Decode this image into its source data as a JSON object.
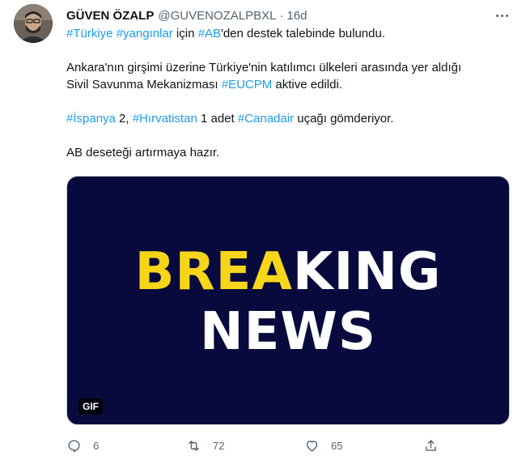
{
  "tweet": {
    "author_name": "GÜVEN ÖZALP",
    "author_handle": "@GUVENOZALPBXL",
    "separator": "·",
    "time": "16d",
    "lines": {
      "l1": {
        "t1": "#Türkiye",
        "t2": " ",
        "t3": "#yangınlar",
        "t4": " için ",
        "t5": "#AB",
        "t6": "'den destek talebinde bulundu."
      },
      "l2": {
        "t1": "Ankara'nın girşimi üzerine Türkiye'nin katılımcı ülkeleri arasında yer aldığı"
      },
      "l3": {
        "t1": "Sivil Savunma Mekanizması ",
        "t2": "#EUCPM",
        "t3": " aktive edildi."
      },
      "l4": {
        "t1": "#İspanya",
        "t2": " 2, ",
        "t3": "#Hırvatistan",
        "t4": " 1 adet ",
        "t5": "#Canadair",
        "t6": " uçağı gömderiyor."
      },
      "l5": {
        "t1": "AB deseteği artırmaya hazır."
      }
    },
    "media": {
      "headline_part1_highlight": "BREA",
      "headline_part1_rest": "KING",
      "headline_part2": "NEWS",
      "badge": "GIF"
    },
    "actions": {
      "reply_count": "6",
      "retweet_count": "72",
      "like_count": "65"
    },
    "colors": {
      "link": "#1d9bf0",
      "media_background": "#080a3d",
      "headline_highlight": "#f7d619",
      "muted": "#536471"
    },
    "icons": [
      "more-icon",
      "reply-icon",
      "retweet-icon",
      "like-icon",
      "share-icon"
    ]
  }
}
